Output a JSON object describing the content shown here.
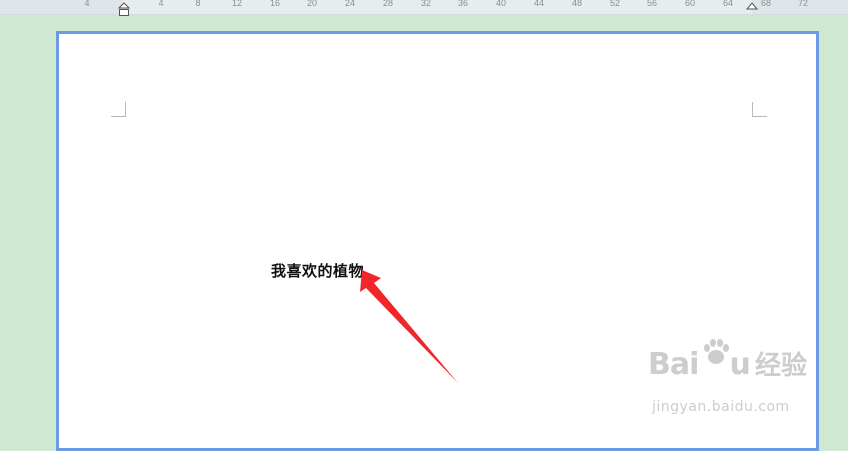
{
  "ruler": {
    "ticks": [
      "4",
      "4",
      "8",
      "12",
      "16",
      "20",
      "24",
      "28",
      "32",
      "36",
      "40",
      "44",
      "48",
      "52",
      "56",
      "60",
      "64",
      "68",
      "72"
    ]
  },
  "document": {
    "text": "我喜欢的植物"
  },
  "watermark": {
    "brand": "Bai",
    "brand_suffix": "u",
    "brand_cn": "经验",
    "url": "jingyan.baidu.com"
  },
  "colors": {
    "background": "#cfe8d2",
    "page_border": "#6d9ae4",
    "arrow": "#f0262a"
  }
}
